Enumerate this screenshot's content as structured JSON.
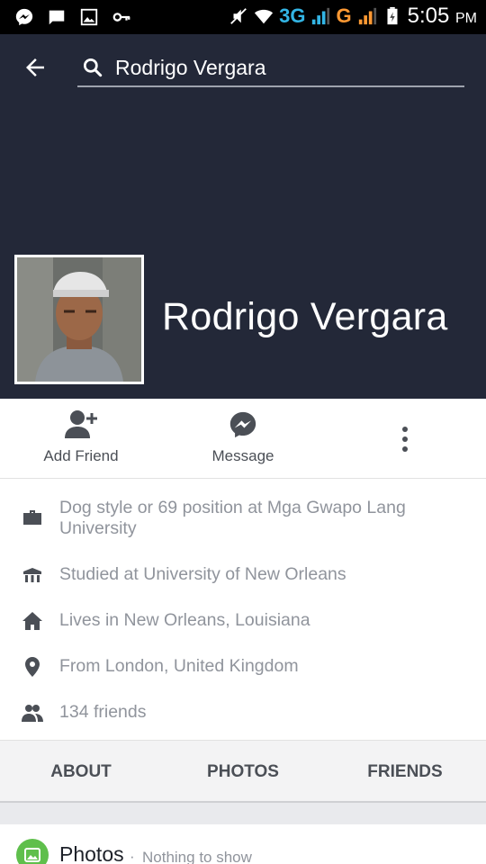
{
  "status_bar": {
    "network_3g": "3G",
    "network_g": "G",
    "time": "5:05",
    "ampm": "PM",
    "icons": [
      "messenger-icon",
      "message-icon",
      "image-icon",
      "key-icon",
      "mute-icon",
      "wifi-icon",
      "signal-icon",
      "battery-icon"
    ]
  },
  "header": {
    "search_value": "Rodrigo Vergara"
  },
  "profile": {
    "name": "Rodrigo Vergara"
  },
  "actions": {
    "add_friend": "Add Friend",
    "message": "Message"
  },
  "info": {
    "work": "Dog style or 69 position at Mga Gwapo Lang University",
    "education": "Studied at University of New Orleans",
    "lives": "Lives in New Orleans, Louisiana",
    "from": "From London, United Kingdom",
    "friends": "134 friends"
  },
  "tabs": {
    "about": "ABOUT",
    "photos": "PHOTOS",
    "friends": "FRIENDS"
  },
  "photos_section": {
    "title": "Photos",
    "separator": "·",
    "subtitle": "Nothing to show"
  },
  "colors": {
    "cover": "#232838",
    "status_3g": "#33b5e5",
    "status_g": "#ff9933",
    "photos_green": "#5fbf4c"
  }
}
